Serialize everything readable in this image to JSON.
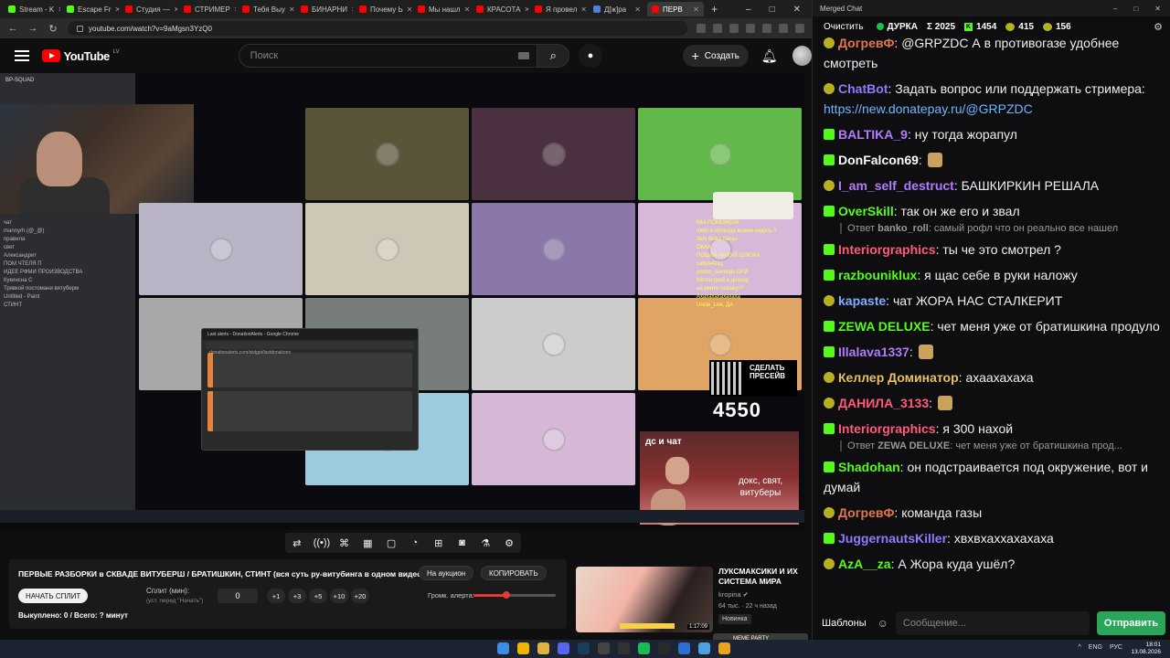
{
  "browser": {
    "tabs": [
      {
        "label": "Stream - K",
        "color": "#53fc18"
      },
      {
        "label": "Escape Fr",
        "color": "#53fc18"
      },
      {
        "label": "Студия —",
        "color": "#ff0000"
      },
      {
        "label": "СТРИМЕР",
        "color": "#ff0000"
      },
      {
        "label": "Тебя Выу",
        "color": "#ff0000"
      },
      {
        "label": "БИНАРНИ",
        "color": "#ff0000"
      },
      {
        "label": "Почему Ь",
        "color": "#ff0000"
      },
      {
        "label": "Мы нашл",
        "color": "#ff0000"
      },
      {
        "label": "КРАСОТА",
        "color": "#ff0000"
      },
      {
        "label": "Я провел",
        "color": "#ff0000"
      },
      {
        "label": "Д[ж]ра",
        "color": "#4f7fd8"
      },
      {
        "label": "ПЕРВ",
        "color": "#ff0000"
      }
    ],
    "url": "youtube.com/watch?v=9aMgsn3YzQ0"
  },
  "youtube": {
    "logo": "YouTube",
    "region": "LV",
    "search_placeholder": "Поиск",
    "create_label": "Создать"
  },
  "video": {
    "discord_server": "BP-SQUAD",
    "discord_channels": [
      "чат",
      "mannyrh (@_@)",
      "правила",
      "свет",
      "Александрит",
      "ПОМ ЧТЕЛЯ П",
      "ИДЕЕ РФМИ ПРОИЗВОДСТВА",
      "Кукинсна С",
      "Трявкой постомани витуберм",
      "Untitled - Paint",
      "СТИНТ"
    ],
    "overlay_chat": [
      "МЫ ПОМОЖЕМ!",
      "mem в облкаде можно кидать ?",
      "dani Вова пахан",
      "ОКАК",
      "ПОШЛА НАХУЙ ШЛЮХА",
      "sabye41kg",
      "potato_sterlings ОПА",
      "Меллстрой и доксер",
      "на ренте покажут?",
      "Ахахахахахахаха",
      "Uncle_Lee, ДА"
    ],
    "qr_text": "СДЕЛАТЬ ПРЕСЕЙВ",
    "counter": "4550",
    "dc_label": "дс и чат",
    "room_text": "докс, свят, витуберы",
    "popup_title": "Last alerts - DonationAlerts - Google Chrome",
    "popup_url": "donationalerts.com/widget/lastdonations"
  },
  "grid_colors": [
    "#ffffff00",
    "#5a5538",
    "#4a3040",
    "#63b84a",
    "#b9b3c6",
    "#cfc7b6",
    "#8a76a8",
    "#d7b8d9",
    "#a8a8a8",
    "#777d78",
    "#cccccc",
    "#e0a564",
    "#ffffff00",
    "#9ccbe0",
    "#d6b8d6",
    "#ffffff00"
  ],
  "controls": {
    "icons": [
      "shuffle-icon",
      "broadcast-icon",
      "gamepad-icon",
      "clapper-icon",
      "crop-icon",
      "gauge-icon",
      "plus-box-icon",
      "camera-icon",
      "flask-icon",
      "gear-icon"
    ],
    "video_title": "ПЕРВЫЕ РАЗБОРКИ в СКВАДЕ ВИТУБЕРШ / БРАТИШКИН, СТИНТ (вся суть ру-витубинга в одном видео)",
    "auction_btn": "На аукцион",
    "copy_btn": "КОПИРОВАТЬ",
    "start_split": "НАЧАТЬ СПЛИТ",
    "split_label": "Сплит (мин):",
    "split_hint": "(уст. перед \"Начать\")",
    "split_value": "0",
    "steps": [
      "+1",
      "+3",
      "+5",
      "+10",
      "+20"
    ],
    "volume_label": "Громк. алерта:",
    "volume": 0.4,
    "bought": "Выкуплено: 0 / Всего: ? минут"
  },
  "recommendation": {
    "title": "ЛУКСМАКСИКИ И ИХ СИСТЕМА МИРА",
    "channel": "kropina ✔",
    "meta": "64 тыс. · 22 ч назад",
    "badge": "Новинка",
    "duration": "1:17:09"
  },
  "taskbar": {
    "icons": [
      {
        "name": "windows-start-icon",
        "color": "#3a8ee6"
      },
      {
        "name": "chrome-icon",
        "color": "#f3b400"
      },
      {
        "name": "folder-icon",
        "color": "#e0b33e"
      },
      {
        "name": "discord-icon",
        "color": "#5865f2"
      },
      {
        "name": "steam-icon",
        "color": "#1b3c5a"
      },
      {
        "name": "app-icon",
        "color": "#444"
      },
      {
        "name": "obs-icon",
        "color": "#333"
      },
      {
        "name": "spotify-icon",
        "color": "#1db954"
      },
      {
        "name": "app-icon-2",
        "color": "#2a2a2a"
      },
      {
        "name": "app-icon-3",
        "color": "#2d6fd0"
      },
      {
        "name": "app-icon-4",
        "color": "#4aa3df"
      },
      {
        "name": "app-icon-5",
        "color": "#e8a420"
      }
    ],
    "tray": [
      "^",
      "ENG",
      "РУС"
    ],
    "time": "18:01",
    "date": "13.08.2026",
    "game_widget": "MEME PARTY"
  },
  "chat": {
    "window_title": "Merged Chat",
    "clear_btn": "Очистить",
    "streamer": "ДУРКА",
    "total": "Σ 2025",
    "kick_count": "1454",
    "twitch_count": "415",
    "twitch_count2": "156",
    "messages": [
      {
        "platform": "twitch",
        "user": "ДогревФ",
        "color": "#e0774a",
        "text": "@GRPZDC А в противогазе удобнее смотреть"
      },
      {
        "platform": "twitch",
        "user": "ChatBot",
        "color": "#8e7cff",
        "text": "Задать вопрос или поддержать стримера: ",
        "link": "https://new.donatepay.ru/@GRPZDC"
      },
      {
        "platform": "kick",
        "user": "BALTIKA_9",
        "color": "#b07cff",
        "text": "ну тогда жорапул"
      },
      {
        "platform": "kick",
        "user": "DonFalcon69",
        "color": "#ffffff",
        "text": "",
        "emote": true
      },
      {
        "platform": "twitch",
        "user": "I_am_self_destruct",
        "color": "#b07cff",
        "text": "БАШКИРКИН РЕШАЛА"
      },
      {
        "platform": "kick",
        "user": "OverSkill",
        "color": "#53fc18",
        "text": "так он же его и звал",
        "reply_user": "banko_roll",
        "reply_text": "самый рофл что он реально все нашел"
      },
      {
        "platform": "kick",
        "user": "Interiorgraphics",
        "color": "#ff5a7a",
        "text": "ты че это смотрел ?"
      },
      {
        "platform": "kick",
        "user": "razbouniklux",
        "color": "#53fc18",
        "text": "я щас себе в руки наложу"
      },
      {
        "platform": "twitch",
        "user": "kapaste",
        "color": "#7fb0ff",
        "text": "чат ЖОРА НАС СТАЛКЕРИТ"
      },
      {
        "platform": "kick",
        "user": "ZEWA DELUXE",
        "color": "#53fc18",
        "text": "чет меня уже от братишкина продуло"
      },
      {
        "platform": "kick",
        "user": "Illalava1337",
        "color": "#b07cff",
        "text": "",
        "emote": true
      },
      {
        "platform": "twitch",
        "user": "Келлер Доминатор",
        "color": "#e8c060",
        "text": "ахаахахаха"
      },
      {
        "platform": "twitch",
        "user": "ДАНИЛА_3133",
        "color": "#ff5a7a",
        "text": "",
        "emote": true
      },
      {
        "platform": "kick",
        "user": "Interiorgraphics",
        "color": "#ff5a7a",
        "text": "я 300 нахой",
        "reply_user": "ZEWA DELUXE",
        "reply_text": "чет меня уже от братишкина прод..."
      },
      {
        "platform": "kick",
        "user": "Shadohan",
        "color": "#53fc18",
        "text": "он подстраивается под окружение, вот и думай"
      },
      {
        "platform": "twitch",
        "user": "ДогревФ",
        "color": "#e0774a",
        "text": "команда газы"
      },
      {
        "platform": "kick",
        "user": "JuggernautsKiller",
        "color": "#8e7cff",
        "text": "хвхвхаххахахаха"
      },
      {
        "platform": "twitch",
        "user": "AzA__za",
        "color": "#53fc18",
        "text": "А Жора куда ушёл?"
      }
    ],
    "templates_btn": "Шаблоны",
    "input_placeholder": "Сообщение...",
    "send_btn": "Отправить"
  }
}
